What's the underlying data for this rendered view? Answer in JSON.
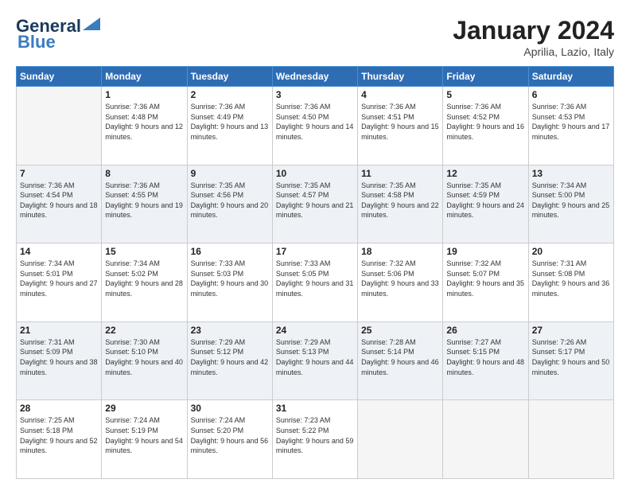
{
  "header": {
    "logo_line1": "General",
    "logo_line2": "Blue",
    "month_title": "January 2024",
    "location": "Aprilia, Lazio, Italy"
  },
  "weekdays": [
    "Sunday",
    "Monday",
    "Tuesday",
    "Wednesday",
    "Thursday",
    "Friday",
    "Saturday"
  ],
  "weeks": [
    [
      {
        "day": "",
        "empty": true
      },
      {
        "day": "1",
        "sunrise": "Sunrise: 7:36 AM",
        "sunset": "Sunset: 4:48 PM",
        "daylight": "Daylight: 9 hours and 12 minutes."
      },
      {
        "day": "2",
        "sunrise": "Sunrise: 7:36 AM",
        "sunset": "Sunset: 4:49 PM",
        "daylight": "Daylight: 9 hours and 13 minutes."
      },
      {
        "day": "3",
        "sunrise": "Sunrise: 7:36 AM",
        "sunset": "Sunset: 4:50 PM",
        "daylight": "Daylight: 9 hours and 14 minutes."
      },
      {
        "day": "4",
        "sunrise": "Sunrise: 7:36 AM",
        "sunset": "Sunset: 4:51 PM",
        "daylight": "Daylight: 9 hours and 15 minutes."
      },
      {
        "day": "5",
        "sunrise": "Sunrise: 7:36 AM",
        "sunset": "Sunset: 4:52 PM",
        "daylight": "Daylight: 9 hours and 16 minutes."
      },
      {
        "day": "6",
        "sunrise": "Sunrise: 7:36 AM",
        "sunset": "Sunset: 4:53 PM",
        "daylight": "Daylight: 9 hours and 17 minutes."
      }
    ],
    [
      {
        "day": "7",
        "sunrise": "Sunrise: 7:36 AM",
        "sunset": "Sunset: 4:54 PM",
        "daylight": "Daylight: 9 hours and 18 minutes."
      },
      {
        "day": "8",
        "sunrise": "Sunrise: 7:36 AM",
        "sunset": "Sunset: 4:55 PM",
        "daylight": "Daylight: 9 hours and 19 minutes."
      },
      {
        "day": "9",
        "sunrise": "Sunrise: 7:35 AM",
        "sunset": "Sunset: 4:56 PM",
        "daylight": "Daylight: 9 hours and 20 minutes."
      },
      {
        "day": "10",
        "sunrise": "Sunrise: 7:35 AM",
        "sunset": "Sunset: 4:57 PM",
        "daylight": "Daylight: 9 hours and 21 minutes."
      },
      {
        "day": "11",
        "sunrise": "Sunrise: 7:35 AM",
        "sunset": "Sunset: 4:58 PM",
        "daylight": "Daylight: 9 hours and 22 minutes."
      },
      {
        "day": "12",
        "sunrise": "Sunrise: 7:35 AM",
        "sunset": "Sunset: 4:59 PM",
        "daylight": "Daylight: 9 hours and 24 minutes."
      },
      {
        "day": "13",
        "sunrise": "Sunrise: 7:34 AM",
        "sunset": "Sunset: 5:00 PM",
        "daylight": "Daylight: 9 hours and 25 minutes."
      }
    ],
    [
      {
        "day": "14",
        "sunrise": "Sunrise: 7:34 AM",
        "sunset": "Sunset: 5:01 PM",
        "daylight": "Daylight: 9 hours and 27 minutes."
      },
      {
        "day": "15",
        "sunrise": "Sunrise: 7:34 AM",
        "sunset": "Sunset: 5:02 PM",
        "daylight": "Daylight: 9 hours and 28 minutes."
      },
      {
        "day": "16",
        "sunrise": "Sunrise: 7:33 AM",
        "sunset": "Sunset: 5:03 PM",
        "daylight": "Daylight: 9 hours and 30 minutes."
      },
      {
        "day": "17",
        "sunrise": "Sunrise: 7:33 AM",
        "sunset": "Sunset: 5:05 PM",
        "daylight": "Daylight: 9 hours and 31 minutes."
      },
      {
        "day": "18",
        "sunrise": "Sunrise: 7:32 AM",
        "sunset": "Sunset: 5:06 PM",
        "daylight": "Daylight: 9 hours and 33 minutes."
      },
      {
        "day": "19",
        "sunrise": "Sunrise: 7:32 AM",
        "sunset": "Sunset: 5:07 PM",
        "daylight": "Daylight: 9 hours and 35 minutes."
      },
      {
        "day": "20",
        "sunrise": "Sunrise: 7:31 AM",
        "sunset": "Sunset: 5:08 PM",
        "daylight": "Daylight: 9 hours and 36 minutes."
      }
    ],
    [
      {
        "day": "21",
        "sunrise": "Sunrise: 7:31 AM",
        "sunset": "Sunset: 5:09 PM",
        "daylight": "Daylight: 9 hours and 38 minutes."
      },
      {
        "day": "22",
        "sunrise": "Sunrise: 7:30 AM",
        "sunset": "Sunset: 5:10 PM",
        "daylight": "Daylight: 9 hours and 40 minutes."
      },
      {
        "day": "23",
        "sunrise": "Sunrise: 7:29 AM",
        "sunset": "Sunset: 5:12 PM",
        "daylight": "Daylight: 9 hours and 42 minutes."
      },
      {
        "day": "24",
        "sunrise": "Sunrise: 7:29 AM",
        "sunset": "Sunset: 5:13 PM",
        "daylight": "Daylight: 9 hours and 44 minutes."
      },
      {
        "day": "25",
        "sunrise": "Sunrise: 7:28 AM",
        "sunset": "Sunset: 5:14 PM",
        "daylight": "Daylight: 9 hours and 46 minutes."
      },
      {
        "day": "26",
        "sunrise": "Sunrise: 7:27 AM",
        "sunset": "Sunset: 5:15 PM",
        "daylight": "Daylight: 9 hours and 48 minutes."
      },
      {
        "day": "27",
        "sunrise": "Sunrise: 7:26 AM",
        "sunset": "Sunset: 5:17 PM",
        "daylight": "Daylight: 9 hours and 50 minutes."
      }
    ],
    [
      {
        "day": "28",
        "sunrise": "Sunrise: 7:25 AM",
        "sunset": "Sunset: 5:18 PM",
        "daylight": "Daylight: 9 hours and 52 minutes."
      },
      {
        "day": "29",
        "sunrise": "Sunrise: 7:24 AM",
        "sunset": "Sunset: 5:19 PM",
        "daylight": "Daylight: 9 hours and 54 minutes."
      },
      {
        "day": "30",
        "sunrise": "Sunrise: 7:24 AM",
        "sunset": "Sunset: 5:20 PM",
        "daylight": "Daylight: 9 hours and 56 minutes."
      },
      {
        "day": "31",
        "sunrise": "Sunrise: 7:23 AM",
        "sunset": "Sunset: 5:22 PM",
        "daylight": "Daylight: 9 hours and 59 minutes."
      },
      {
        "day": "",
        "empty": true
      },
      {
        "day": "",
        "empty": true
      },
      {
        "day": "",
        "empty": true
      }
    ]
  ]
}
